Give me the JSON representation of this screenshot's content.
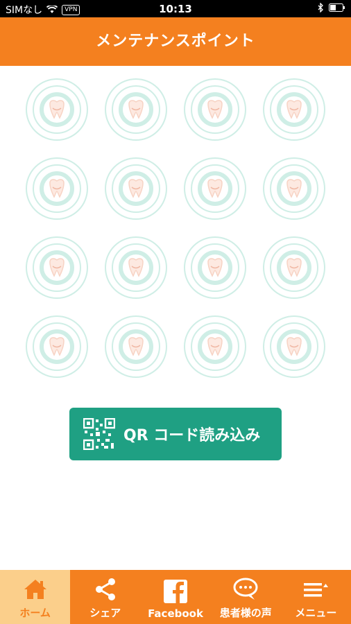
{
  "status_bar": {
    "carrier": "SIMなし",
    "vpn": "VPN",
    "time": "10:13"
  },
  "header": {
    "title": "メンテナンスポイント"
  },
  "stamp_card": {
    "rows": 4,
    "columns": 4,
    "stamps_collected": 0,
    "stamp_icon": "tooth-logo-icon"
  },
  "qr_button": {
    "label": "QR コード読み込み",
    "icon": "qr-code-icon"
  },
  "tab_bar": {
    "tabs": [
      {
        "label": "ホーム",
        "icon": "home-icon",
        "active": true
      },
      {
        "label": "シェア",
        "icon": "share-icon",
        "active": false
      },
      {
        "label": "Facebook",
        "icon": "facebook-icon",
        "active": false
      },
      {
        "label": "患者様の声",
        "icon": "speech-bubble-icon",
        "active": false
      },
      {
        "label": "メニュー",
        "icon": "menu-icon",
        "active": false
      }
    ]
  },
  "colors": {
    "primary": "#f4801f",
    "active_tab": "#fbcf8b",
    "qr_button": "#1fa083",
    "stamp_teal": "#cfeee6",
    "stamp_pink": "#f7d3c4"
  }
}
